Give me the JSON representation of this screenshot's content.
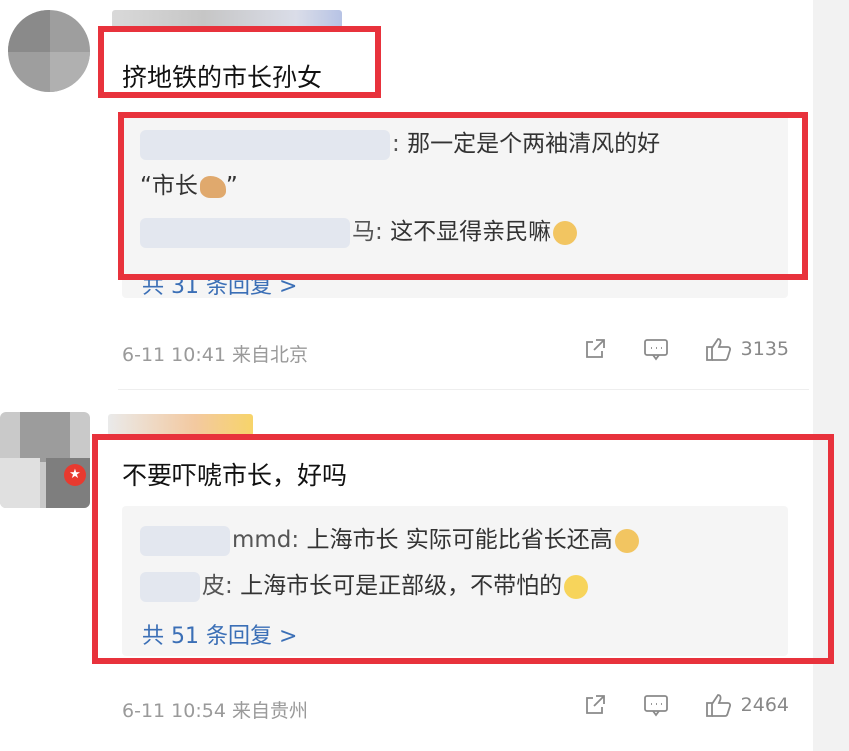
{
  "comments": [
    {
      "text": "挤地铁的市长孙女",
      "replies": [
        {
          "name": ":",
          "text": "那一定是个两袖清风的好",
          "text2": "“市长",
          "text2_end": "”"
        },
        {
          "name": "马:",
          "text": "这不显得亲民嘛"
        }
      ],
      "more_label": "共 31 条回复 >",
      "time": "6-11 10:41",
      "source": "来自北京",
      "like_count": "3135"
    },
    {
      "text": "不要吓唬市长，好吗",
      "replies": [
        {
          "name": "mmd:",
          "text": "上海市长 实际可能比省长还高"
        },
        {
          "name": "皮:",
          "text": "上海市长可是正部级，不带怕的"
        }
      ],
      "more_label": "共 51 条回复 >",
      "time": "6-11 10:54",
      "source": "来自贵州",
      "like_count": "2464"
    }
  ],
  "colors": {
    "highlight_frame": "#e8323c",
    "link": "#3b6fb6",
    "meta": "#9a9a9a"
  },
  "icons": [
    "share-icon",
    "comment-icon",
    "like-icon",
    "vip-badge-icon"
  ]
}
